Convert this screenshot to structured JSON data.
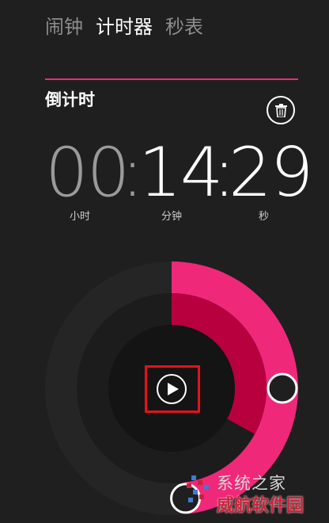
{
  "tabs": [
    {
      "label": "闹钟",
      "active": false
    },
    {
      "label": "计时器",
      "active": true
    },
    {
      "label": "秒表",
      "active": false
    }
  ],
  "timer": {
    "name": "倒计时",
    "hours": "00",
    "minutes": "14",
    "seconds": "29",
    "separator": ":",
    "unit_hours": "小时",
    "unit_minutes": "分钟",
    "unit_seconds": "秒"
  },
  "progress": {
    "remaining_fraction": 0.48,
    "inner_fraction": 0.33
  },
  "colors": {
    "accent": "#f0287a",
    "inner_ring": "#b8003e",
    "highlight_box": "#e3131c",
    "background": "#1f1f1f"
  },
  "icons": {
    "delete": "trash-icon",
    "play": "play-icon"
  },
  "watermark": {
    "line1": "系统之家",
    "line2": "威航软件园"
  }
}
